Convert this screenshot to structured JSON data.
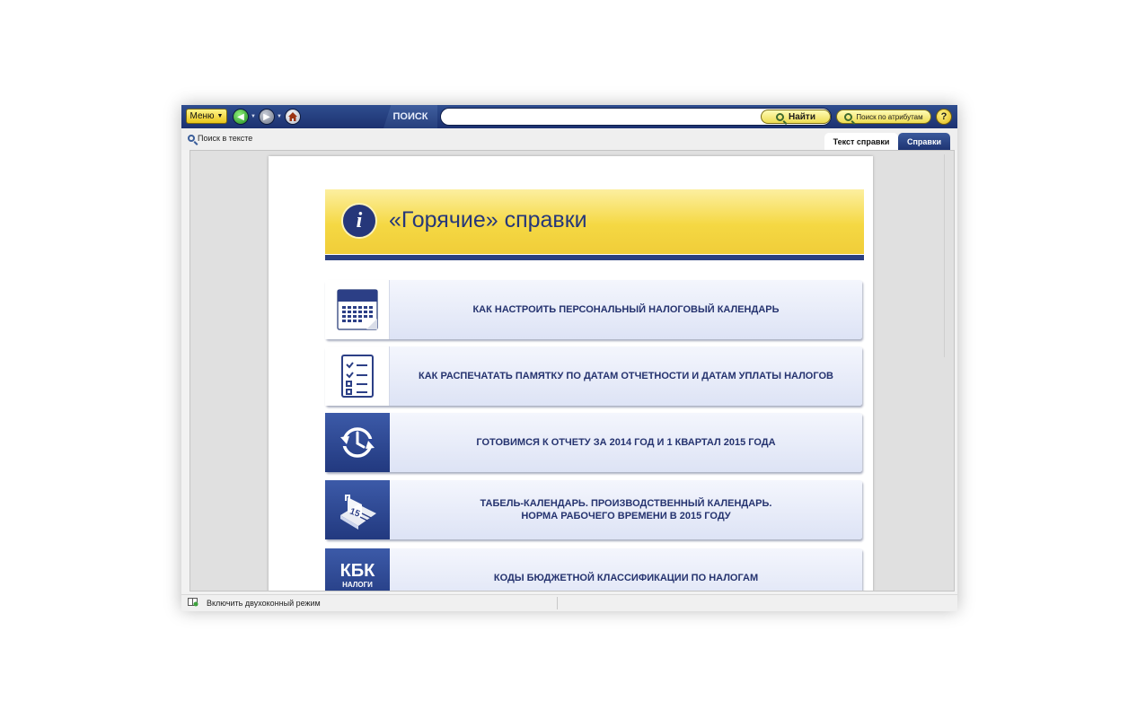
{
  "toolbar": {
    "menu_label": "Меню",
    "search_tab_label": "ПОИСК",
    "find_button_label": "Найти",
    "attr_search_label": "Поиск по атрибутам",
    "help_label": "?"
  },
  "subbar": {
    "search_in_text_label": "Поиск в тексте",
    "tabs": [
      {
        "label": "Текст справки",
        "active": true
      },
      {
        "label": "Справки",
        "active": false
      }
    ]
  },
  "banner": {
    "info_glyph": "i",
    "title": "«Горячие» справки"
  },
  "items": [
    {
      "icon": "calendar-icon",
      "label": "КАК НАСТРОИТЬ ПЕРСОНАЛЬНЫЙ НАЛОГОВЫЙ КАЛЕНДАРЬ"
    },
    {
      "icon": "checklist-icon",
      "label": "КАК РАСПЕЧАТАТЬ ПАМЯТКУ ПО ДАТАМ ОТЧЕТНОСТИ И ДАТАМ УПЛАТЫ НАЛОГОВ"
    },
    {
      "icon": "refresh-clock-icon",
      "label": "ГОТОВИМСЯ К ОТЧЕТУ ЗА 2014 ГОД И 1 КВАРТАЛ 2015 ГОДА"
    },
    {
      "icon": "desk-calendar-icon",
      "label_line1": "ТАБЕЛЬ-КАЛЕНДАРЬ. ПРОИЗВОДСТВЕННЫЙ КАЛЕНДАРЬ.",
      "label_line2": "НОРМА РАБОЧЕГО ВРЕМЕНИ В 2015 ГОДУ"
    },
    {
      "icon": "kbk-icon",
      "icon_text": "КБК",
      "icon_subtext": "НАЛОГИ",
      "label": "КОДЫ БЮДЖЕТНОЙ КЛАССИФИКАЦИИ ПО НАЛОГАМ"
    }
  ],
  "statusbar": {
    "dual_window_label": "Включить двухоконный режим"
  },
  "colors": {
    "toolbar_blue": "#1c3170",
    "banner_yellow": "#f5d843",
    "accent_navy": "#26377a"
  }
}
